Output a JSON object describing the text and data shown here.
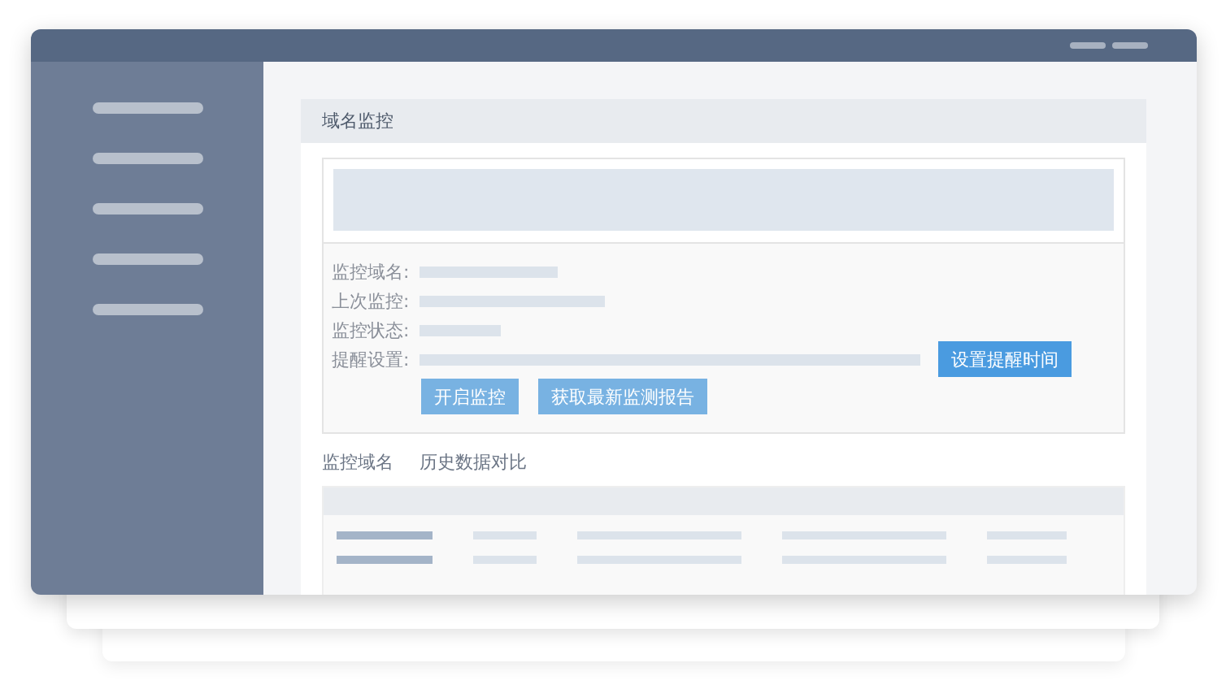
{
  "panel": {
    "title": "域名监控"
  },
  "fields": [
    {
      "label": "监控域名:"
    },
    {
      "label": "上次监控:"
    },
    {
      "label": "监控状态:"
    },
    {
      "label": "提醒设置:"
    }
  ],
  "remind_button": "设置提醒时间",
  "buttons": [
    "开启监控",
    "获取最新监测报告"
  ],
  "tabs": [
    "监控域名",
    "历史数据对比"
  ]
}
